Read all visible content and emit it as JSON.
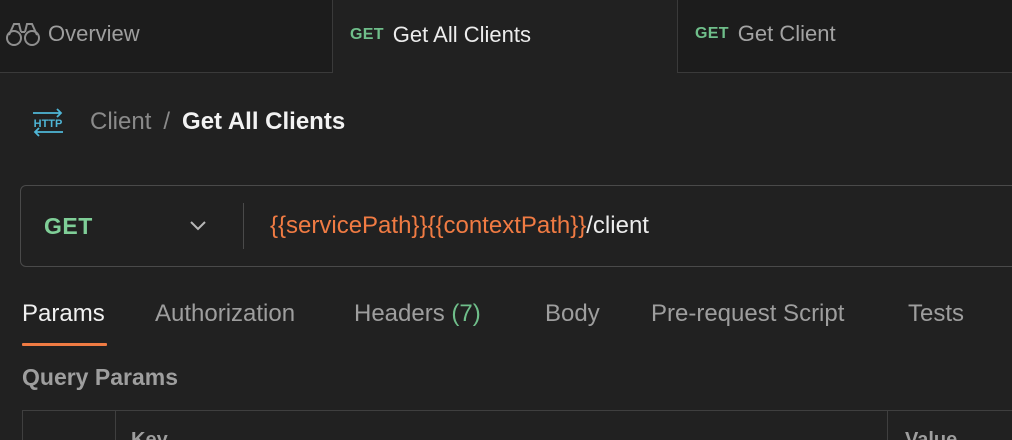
{
  "tabs": [
    {
      "label": "Overview",
      "icon": "binoculars-icon"
    },
    {
      "method": "GET",
      "label": "Get All Clients",
      "active": true
    },
    {
      "method": "GET",
      "label": "Get Client"
    }
  ],
  "breadcrumb": {
    "icon": "http-icon",
    "parent": "Client",
    "separator": "/",
    "current": "Get All Clients"
  },
  "request": {
    "method": "GET",
    "url_parts": [
      {
        "text": "{{servicePath}}",
        "kind": "variable"
      },
      {
        "text": "{{contextPath}}",
        "kind": "variable"
      },
      {
        "text": "/client",
        "kind": "plain"
      }
    ]
  },
  "request_tabs": [
    {
      "label": "Params",
      "active": true
    },
    {
      "label": "Authorization"
    },
    {
      "label": "Headers",
      "count": "(7)"
    },
    {
      "label": "Body"
    },
    {
      "label": "Pre-request Script"
    },
    {
      "label": "Tests"
    }
  ],
  "query_params": {
    "title": "Query Params",
    "columns": [
      "Key",
      "Value"
    ]
  },
  "colors": {
    "background": "#212121",
    "method_green": "#7fce97",
    "variable_orange": "#f07b43",
    "accent_underline": "#f07b43"
  }
}
